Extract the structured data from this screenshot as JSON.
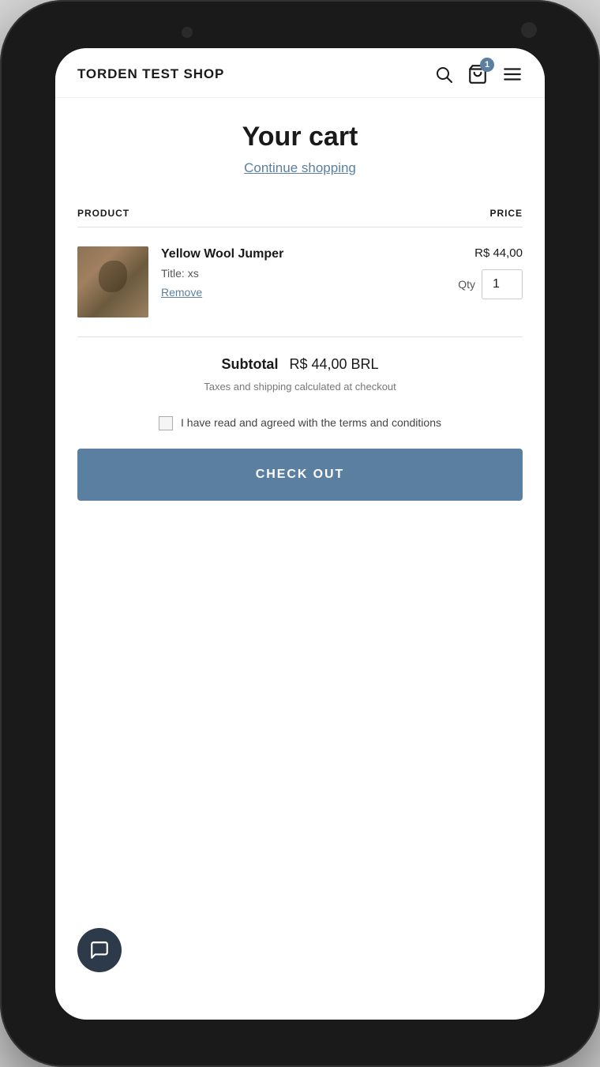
{
  "header": {
    "store_name": "TORDEN TEST SHOP",
    "cart_badge": "1"
  },
  "page": {
    "title": "Your cart",
    "continue_shopping": "Continue shopping"
  },
  "cart_table": {
    "col_product": "PRODUCT",
    "col_price": "PRICE"
  },
  "cart_item": {
    "name": "Yellow Wool Jumper",
    "variant_label": "Title:",
    "variant_value": "xs",
    "price": "R$ 44,00",
    "qty": "1",
    "remove_label": "Remove"
  },
  "subtotal": {
    "label": "Subtotal",
    "value": "R$ 44,00 BRL",
    "taxes_note": "Taxes and shipping calculated at checkout"
  },
  "terms": {
    "text": "I have read and agreed with the terms and conditions"
  },
  "checkout": {
    "label": "CHECK OUT"
  }
}
